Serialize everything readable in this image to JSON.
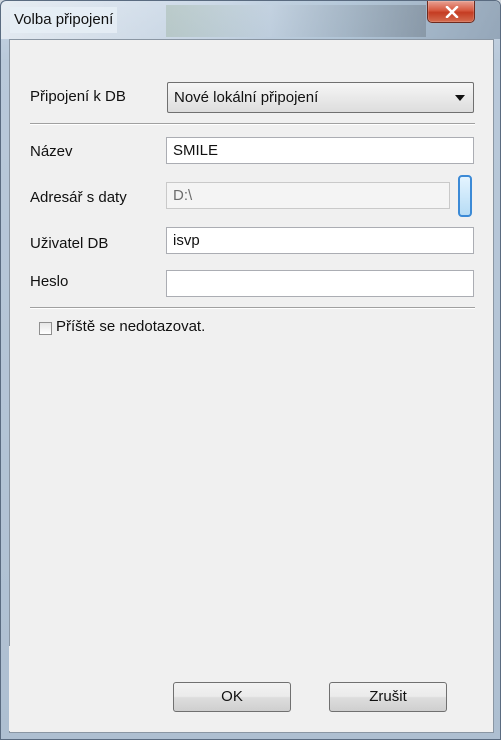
{
  "window": {
    "title": "Volba připojení",
    "close_glyph": "X"
  },
  "form": {
    "connection": {
      "label": "Připojení k DB",
      "value": "Nové lokální připojení"
    },
    "name": {
      "label": "Název",
      "value": "SMILE"
    },
    "data_dir": {
      "label": "Adresář s daty",
      "value": "D:\\"
    },
    "db_user": {
      "label": "Uživatel DB",
      "value": "isvp"
    },
    "password": {
      "label": "Heslo",
      "value": ""
    },
    "dont_ask": {
      "label": "Příště se nedotazovat.",
      "checked": false
    }
  },
  "buttons": {
    "ok": "OK",
    "cancel": "Zrušit"
  },
  "colors": {
    "accent": "#3c8ad6",
    "close": "#c43c22"
  }
}
